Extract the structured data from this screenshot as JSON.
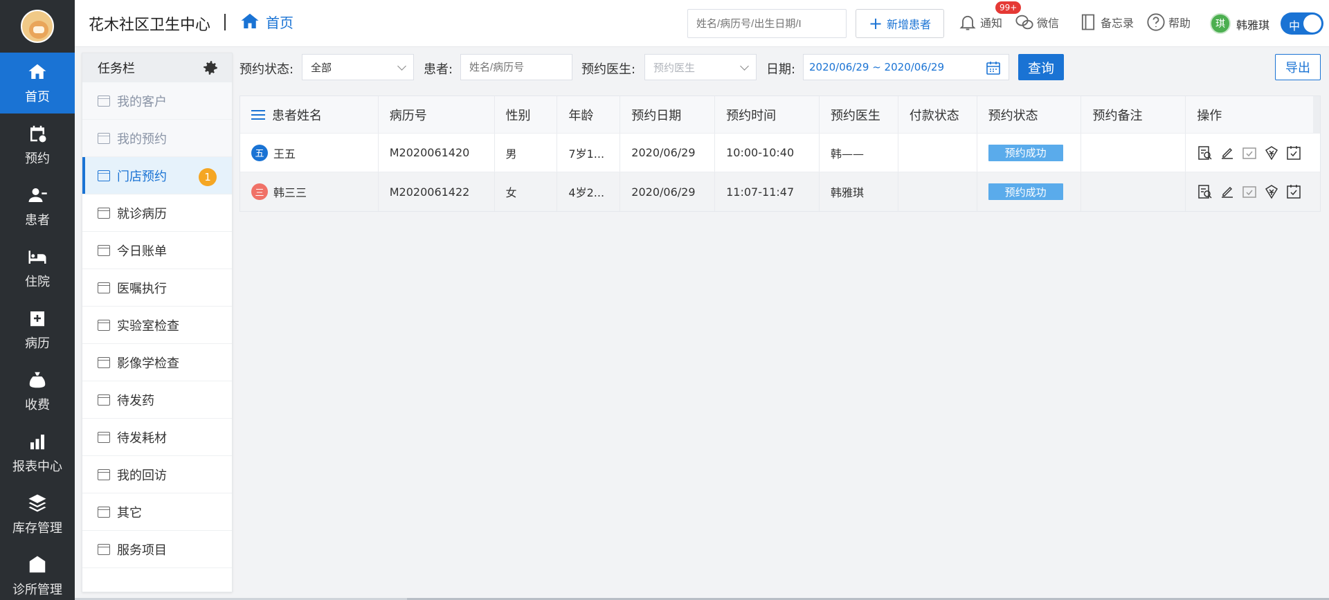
{
  "app": {
    "clinic_name": "花木社区卫生中心",
    "breadcrumb_home": "首页"
  },
  "nav": {
    "items": [
      {
        "label": "首页",
        "icon": "home-icon",
        "active": true
      },
      {
        "label": "预约",
        "icon": "calendar-clock-icon"
      },
      {
        "label": "患者",
        "icon": "user-icon"
      },
      {
        "label": "住院",
        "icon": "bed-icon"
      },
      {
        "label": "病历",
        "icon": "medical-record-icon"
      },
      {
        "label": "收费",
        "icon": "money-bag-icon"
      },
      {
        "label": "报表中心",
        "icon": "bar-chart-icon"
      },
      {
        "label": "库存管理",
        "icon": "layers-icon"
      },
      {
        "label": "诊所管理",
        "icon": "clinic-icon"
      }
    ]
  },
  "header": {
    "search_placeholder": "姓名/病历号/出生日期/I",
    "add_patient_label": "新增患者",
    "notify_label": "通知",
    "notify_badge": "99+",
    "wechat_label": "微信",
    "memo_label": "备忘录",
    "help_label": "帮助",
    "user_avatar_char": "琪",
    "user_name": "韩雅琪",
    "lang_toggle": "中"
  },
  "taskbar": {
    "title": "任务栏",
    "items": [
      {
        "label": "我的客户",
        "state": "dim"
      },
      {
        "label": "我的预约",
        "state": "dim"
      },
      {
        "label": "门店预约",
        "state": "active",
        "count": "1"
      },
      {
        "label": "就诊病历"
      },
      {
        "label": "今日账单"
      },
      {
        "label": "医嘱执行"
      },
      {
        "label": "实验室检查"
      },
      {
        "label": "影像学检查"
      },
      {
        "label": "待发药"
      },
      {
        "label": "待发耗材"
      },
      {
        "label": "我的回访"
      },
      {
        "label": "其它"
      },
      {
        "label": "服务项目"
      }
    ]
  },
  "filters": {
    "status_label": "预约状态:",
    "status_value": "全部",
    "patient_label": "患者:",
    "patient_placeholder": "姓名/病历号",
    "doctor_label": "预约医生:",
    "doctor_placeholder": "预约医生",
    "date_label": "日期:",
    "date_value": "2020/06/29 ~ 2020/06/29",
    "query_label": "查询",
    "export_label": "导出"
  },
  "table": {
    "columns": [
      "患者姓名",
      "病历号",
      "性别",
      "年龄",
      "预约日期",
      "预约时间",
      "预约医生",
      "付款状态",
      "预约状态",
      "预约备注",
      "操作"
    ],
    "rows": [
      {
        "chip": "五",
        "chip_color": "#1a73d4",
        "name": "王五",
        "record": "M2020061420",
        "gender": "男",
        "age": "7岁1...",
        "date": "2020/06/29",
        "time": "10:00-10:40",
        "doctor": "韩——",
        "payment": "",
        "status": "预约成功",
        "note": ""
      },
      {
        "chip": "三",
        "chip_color": "#f07167",
        "name": "韩三三",
        "record": "M2020061422",
        "gender": "女",
        "age": "4岁2...",
        "date": "2020/06/29",
        "time": "11:07-11:47",
        "doctor": "韩雅琪",
        "payment": "",
        "status": "预约成功",
        "note": ""
      }
    ]
  },
  "colors": {
    "primary": "#1a73d4",
    "nav_bg": "#2b2f33",
    "status_pill": "#5aabeb",
    "count_badge": "#f5a623",
    "notify_badge": "#e53935"
  }
}
